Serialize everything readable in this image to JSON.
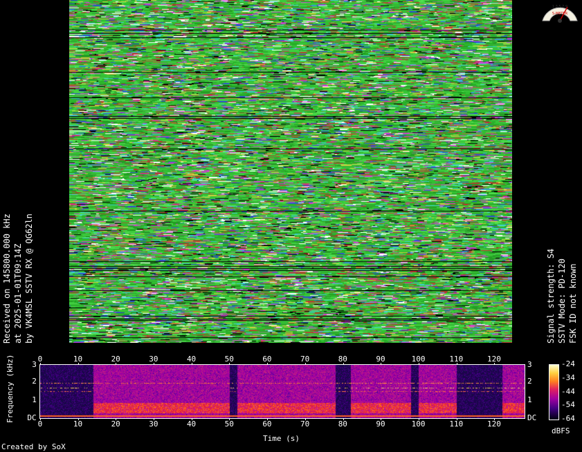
{
  "left_info": {
    "line1": "Received on 145800.000 kHz",
    "line2": "at 2025-01-01T09:14Z",
    "line3": "by VK4MSL SSTV RX @ QG62ln"
  },
  "right_info": {
    "line1": "Signal strength: S4",
    "line2": "SSTV Mode: PD-120",
    "line3": "FSK ID not known"
  },
  "s_meter": {
    "label": "S-METER",
    "scale": "1 3 5 7 9"
  },
  "spectrogram": {
    "time_ticks": [
      "0",
      "10",
      "20",
      "30",
      "40",
      "50",
      "60",
      "70",
      "80",
      "90",
      "100",
      "110",
      "120"
    ],
    "freq_ticks": [
      "3",
      "2",
      "1",
      "DC"
    ],
    "xlabel": "Time (s)",
    "ylabel": "Frequency (kHz)",
    "time_max": 128
  },
  "colorbar": {
    "ticks": [
      "-24",
      "-34",
      "-44",
      "-54",
      "-64"
    ],
    "unit": "dBFS"
  },
  "credit": "Created by SoX",
  "colors": {
    "background": "#000000",
    "sstv_green": "#30c030"
  }
}
